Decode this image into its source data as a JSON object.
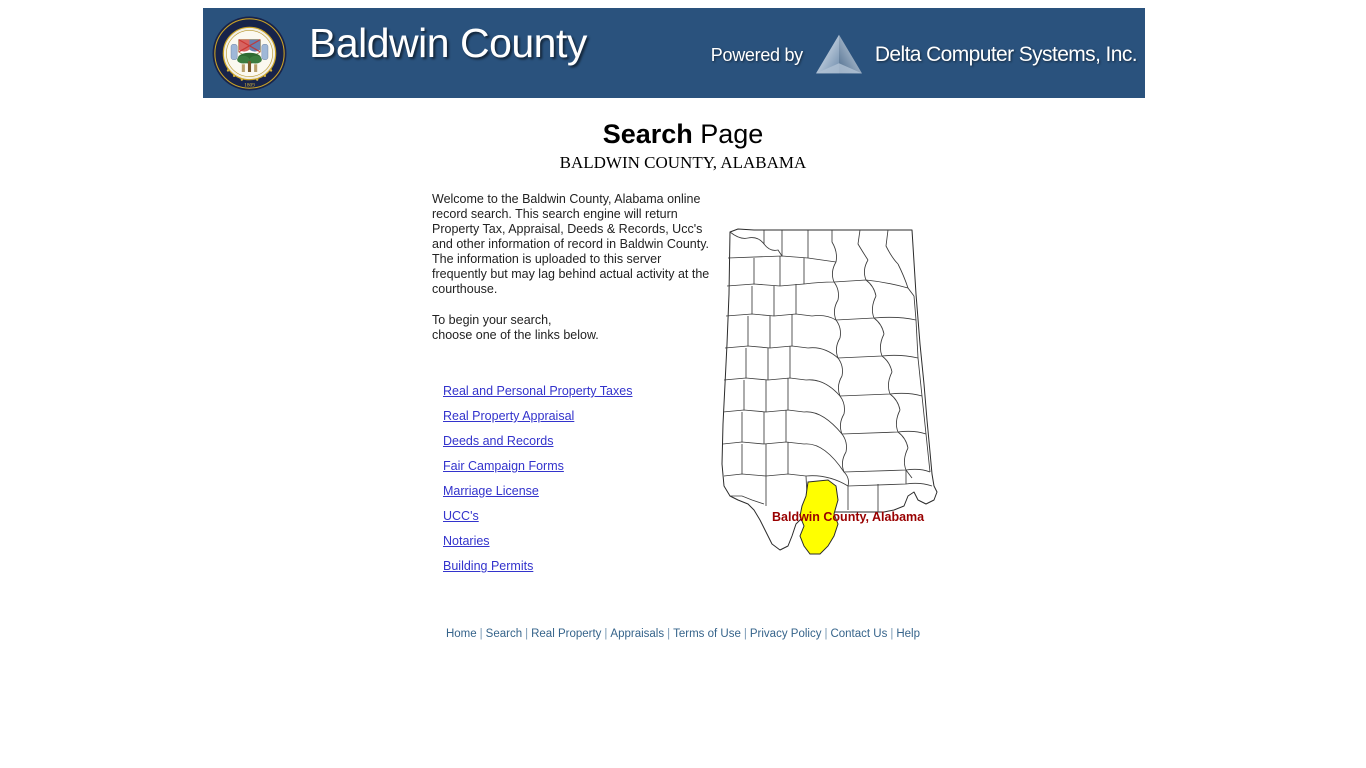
{
  "header": {
    "seal": {
      "icon": "county-seal-icon",
      "ring_text": "THE SEAL OF BALDWIN COUNTY ALABAMA",
      "year": "1809"
    },
    "title": "Baldwin County",
    "powered_by_label": "Powered by",
    "vendor_name": "Delta Computer Systems, Inc.",
    "vendor_logo_icon": "delta-pyramid-icon",
    "background_color": "#2a527d"
  },
  "page": {
    "title_strong": "Search",
    "title_light": " Page",
    "subtitle": "BALDWIN COUNTY, ALABAMA"
  },
  "content": {
    "intro_paragraph": "Welcome to the Baldwin County, Alabama online record search. This search engine will return Property Tax, Appraisal, Deeds & Records, Ucc's and other information of record in Baldwin County. The information is uploaded to this server frequently but may lag behind actual activity at the courthouse.",
    "instruction_line1": "To begin your search,",
    "instruction_line2": "choose one of the links below.",
    "links": [
      {
        "label": "Real and Personal Property Taxes"
      },
      {
        "label": "Real Property Appraisal"
      },
      {
        "label": "Deeds and Records"
      },
      {
        "label": "Fair Campaign Forms"
      },
      {
        "label": "Marriage License"
      },
      {
        "label": "UCC's"
      },
      {
        "label": "Notaries"
      },
      {
        "label": "Building Permits"
      }
    ],
    "link_color": "#3333cc"
  },
  "map": {
    "icon": "alabama-county-map-icon",
    "label": "Baldwin County, Alabama",
    "label_color": "#990000",
    "highlight_color": "#ffff00",
    "highlighted_county": "Baldwin",
    "state": "Alabama"
  },
  "footer": {
    "links": [
      {
        "label": "Home"
      },
      {
        "label": "Search"
      },
      {
        "label": "Real Property"
      },
      {
        "label": "Appraisals"
      },
      {
        "label": "Terms of Use"
      },
      {
        "label": "Privacy Policy"
      },
      {
        "label": "Contact Us"
      },
      {
        "label": "Help"
      }
    ],
    "separator": "|",
    "color": "#36648b"
  }
}
